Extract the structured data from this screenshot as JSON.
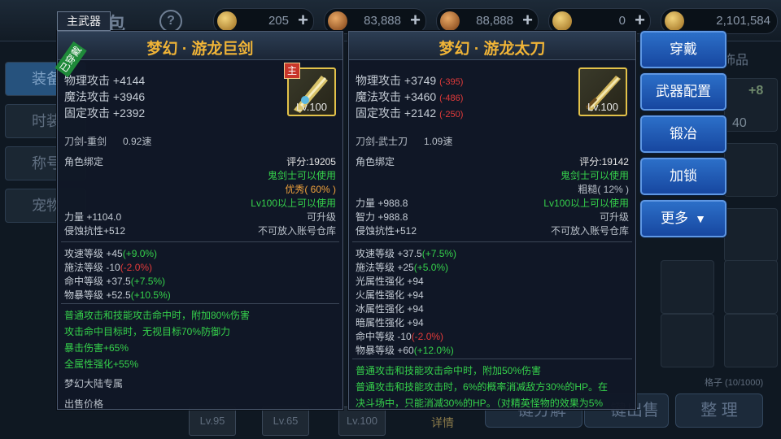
{
  "topbar": {
    "title": "背包",
    "help": "?",
    "currencies": [
      {
        "value": "205",
        "color": "#d7b14c"
      },
      {
        "value": "83,888",
        "color": "#c9823a"
      },
      {
        "value": "88,888",
        "color": "#c9823a"
      },
      {
        "value": "0",
        "color": "#d7b14c"
      },
      {
        "value": "2,101,584",
        "color": "#d7b14c"
      }
    ],
    "plus": "+"
  },
  "sidebar": {
    "tabs": [
      {
        "label": "装备",
        "active": true
      },
      {
        "label": "时装",
        "active": false
      },
      {
        "label": "称号",
        "active": false
      },
      {
        "label": "宠物",
        "active": false
      }
    ]
  },
  "background": {
    "pinned_label": "饰品",
    "plus_value": "+8",
    "count_value": "40",
    "capacity": "格子 (10/1000)",
    "detail_label": "详情",
    "slots": [
      "Lv.95",
      "Lv.65",
      "Lv.100"
    ],
    "bottom_buttons": [
      "一键分解",
      "一键出售",
      "整 理"
    ]
  },
  "left_panel": {
    "tag": "主武器",
    "equipped": "已穿戴",
    "title": "梦幻 · 游龙巨剑",
    "main_badge": "主",
    "icon": {
      "name": "greatsword-icon",
      "level": "Lv.100"
    },
    "attack": [
      {
        "label": "物理攻击 +4144"
      },
      {
        "label": "魔法攻击 +3946"
      },
      {
        "label": "固定攻击 +2392"
      }
    ],
    "weapon_type": "刀剑-重剑",
    "speed": "0.92速",
    "bind": "角色绑定",
    "score": "评分:19205",
    "class_req": "鬼剑士可以使用",
    "quality": "优秀( 60% )",
    "level_req": "Lv100以上可以使用",
    "stat1": "力量 +1104.0",
    "upgrade": "可升级",
    "stat2": "侵蚀抗性+512",
    "storage": "不可放入账号仓库",
    "levels": [
      {
        "base": "攻速等级 +45",
        "diff": "(+9.0%)",
        "tone": "green"
      },
      {
        "base": "施法等级 -10",
        "diff": "(-2.0%)",
        "tone": "red"
      },
      {
        "base": "命中等级 +37.5",
        "diff": "(+7.5%)",
        "tone": "green"
      },
      {
        "base": "物暴等级 +52.5",
        "diff": "(+10.5%)",
        "tone": "green"
      }
    ],
    "effects": [
      "普通攻击和技能攻击命中时，附加80%伤害",
      "攻击命中目标时，无视目标70%防御力",
      "暴击伤害+65%",
      "全属性强化+55%"
    ],
    "exclusive": "梦幻大陆专属",
    "sell_price": "出售价格"
  },
  "right_panel": {
    "title": "梦幻 · 游龙太刀",
    "icon": {
      "name": "katana-icon",
      "level": "Lv.100"
    },
    "attack": [
      {
        "label": "物理攻击 +3749",
        "diff": "(-395)"
      },
      {
        "label": "魔法攻击 +3460",
        "diff": "(-486)"
      },
      {
        "label": "固定攻击 +2142",
        "diff": "(-250)"
      }
    ],
    "weapon_type": "刀剑-武士刀",
    "speed": "1.09速",
    "bind": "角色绑定",
    "score": "评分:19142",
    "class_req": "鬼剑士可以使用",
    "quality": "粗糙( 12% )",
    "level_req": "Lv100以上可以使用",
    "stat1": "力量 +988.8",
    "upgrade": "可升级",
    "stat1b": "智力 +988.8",
    "stat2": "侵蚀抗性+512",
    "storage": "不可放入账号仓库",
    "levels": [
      {
        "base": "攻速等级 +37.5",
        "diff": "(+7.5%)",
        "tone": "green"
      },
      {
        "base": "施法等级 +25",
        "diff": "(+5.0%)",
        "tone": "green"
      },
      {
        "base": "光属性强化 +94",
        "diff": "",
        "tone": ""
      },
      {
        "base": "火属性强化 +94",
        "diff": "",
        "tone": ""
      },
      {
        "base": "冰属性强化 +94",
        "diff": "",
        "tone": ""
      },
      {
        "base": "暗属性强化 +94",
        "diff": "",
        "tone": ""
      },
      {
        "base": "命中等级 -10",
        "diff": "(-2.0%)",
        "tone": "red"
      },
      {
        "base": "物暴等级 +60",
        "diff": "(+12.0%)",
        "tone": "green"
      }
    ],
    "effects": [
      "普通攻击和技能攻击命中时，附加50%伤害",
      "普通攻击和技能攻击时，6%的概率消减敌方30%的HP。在",
      "决斗场中，只能消减30%的HP。（对精英怪物的效果为5%"
    ]
  },
  "actions": [
    {
      "label": "穿戴"
    },
    {
      "label": "武器配置"
    },
    {
      "label": "锻冶"
    },
    {
      "label": "加锁"
    },
    {
      "label": "更多",
      "dropdown": "▼"
    }
  ]
}
